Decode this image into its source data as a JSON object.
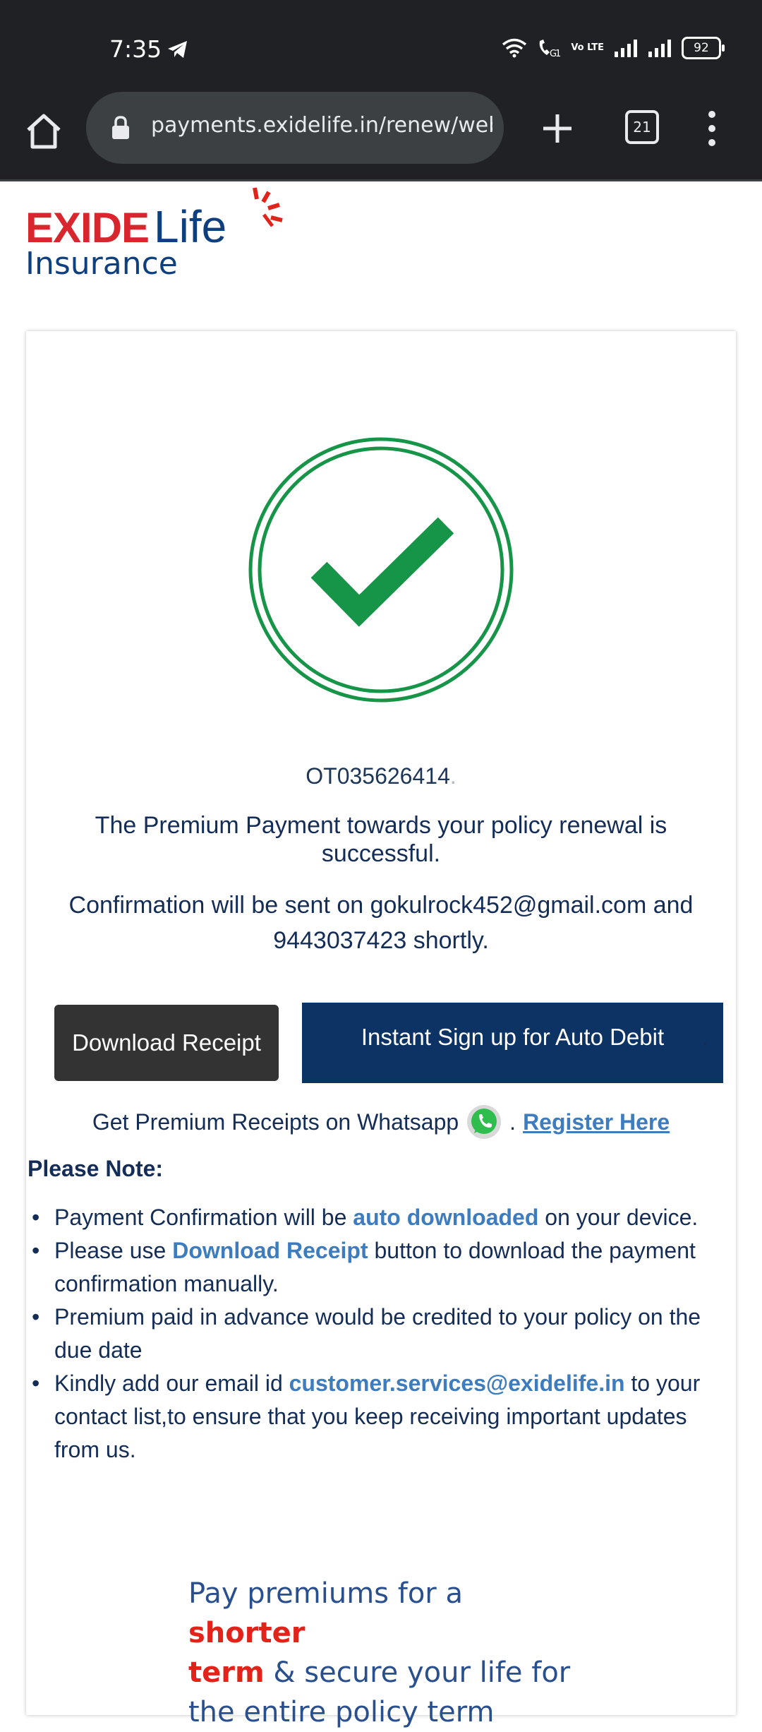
{
  "status_bar": {
    "time": "7:35",
    "volte_label": "Vo LTE",
    "battery": "92"
  },
  "browser": {
    "url": "payments.exidelife.in/renew/web/p",
    "tab_count": "21"
  },
  "logo": {
    "brand_top": "EXIDE",
    "brand_life": "Life",
    "brand_bottom": "Insurance"
  },
  "payment": {
    "transaction_id": "OT035626414",
    "transaction_suffix": ".",
    "success_message": "The Premium Payment towards your policy renewal is successful.",
    "confirmation_message": "Confirmation will be sent on gokulrock452@gmail.com and 9443037423 shortly.",
    "download_receipt_label": "Download Receipt",
    "auto_debit_label": "Instant Sign up for Auto Debit",
    "auto_debit_suffix": ".",
    "whatsapp_text": "Get Premium Receipts on Whatsapp",
    "whatsapp_sep": ".",
    "register_label": "Register Here"
  },
  "notes": {
    "title": "Please Note:",
    "item1_pre": "Payment Confirmation will be ",
    "item1_hl": "auto downloaded",
    "item1_post": " on your device.",
    "item2_pre": "Please use ",
    "item2_hl": "Download Receipt",
    "item2_post": " button to download the payment confirmation manually.",
    "item3": "Premium paid in advance would be credited to your policy on the due date",
    "item4_pre": "Kindly add our email id ",
    "item4_hl": "customer.services@exidelife.in",
    "item4_post": " to your contact list,to ensure that you keep receiving important updates from us."
  },
  "promo": {
    "line1_a": "Pay premiums for a ",
    "line1_b": "shorter",
    "line2_a": "term",
    "line2_b": " & secure your life for",
    "line3": "the entire policy term"
  },
  "colors": {
    "success_green": "#169447",
    "brand_red": "#d7262d",
    "brand_blue": "#0e3f7f",
    "button_navy": "#0d3264",
    "link_blue": "#3c7cbf"
  }
}
